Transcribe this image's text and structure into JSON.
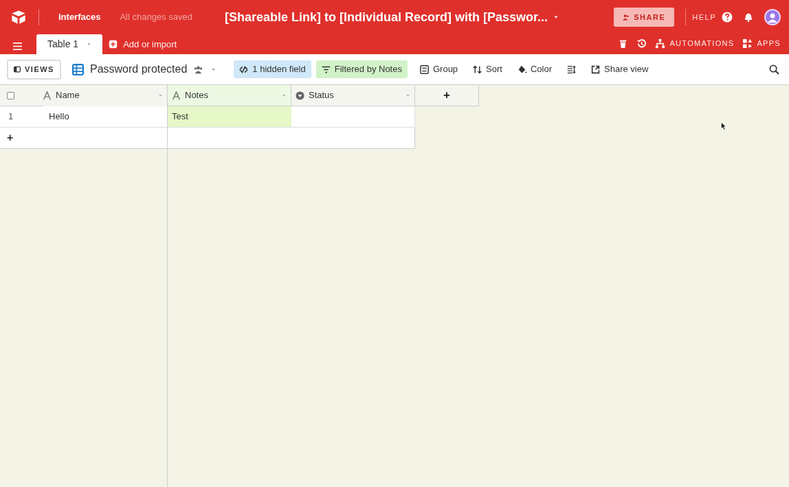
{
  "app_bar": {
    "link": "Interfaces",
    "save_status": "All changes saved",
    "base_title": "[Shareable Link] to [Individual Record] with [Passwor...",
    "share": "SHARE",
    "help": "HELP"
  },
  "tabs": [
    {
      "label": "Table 1",
      "selected": true
    }
  ],
  "add_import": "Add or import",
  "table_tools": [
    {
      "kind": "trash"
    },
    {
      "kind": "history"
    },
    {
      "kind": "automations",
      "label": "AUTOMATIONS"
    },
    {
      "kind": "apps",
      "label": "APPS"
    }
  ],
  "view_bar": {
    "views": "VIEWS",
    "view_name": "Password protected",
    "tools": [
      {
        "kind": "hidden",
        "label": "1 hidden field"
      },
      {
        "kind": "filter",
        "label": "Filtered by Notes"
      },
      {
        "kind": "group",
        "label": "Group"
      },
      {
        "kind": "sort",
        "label": "Sort"
      },
      {
        "kind": "color",
        "label": "Color"
      },
      {
        "kind": "height"
      },
      {
        "kind": "share",
        "label": "Share view"
      }
    ]
  },
  "table": {
    "columns": [
      {
        "name": "Name",
        "kind": "text",
        "filtered": false
      },
      {
        "name": "Notes",
        "kind": "text",
        "filtered": true
      },
      {
        "name": "Status",
        "kind": "select",
        "filtered": false
      }
    ],
    "select_all_checked": false,
    "add_column": "+",
    "rows": [
      {
        "number": "1",
        "cells": [
          "Hello",
          "Test",
          ""
        ]
      }
    ],
    "add_row": "+"
  }
}
